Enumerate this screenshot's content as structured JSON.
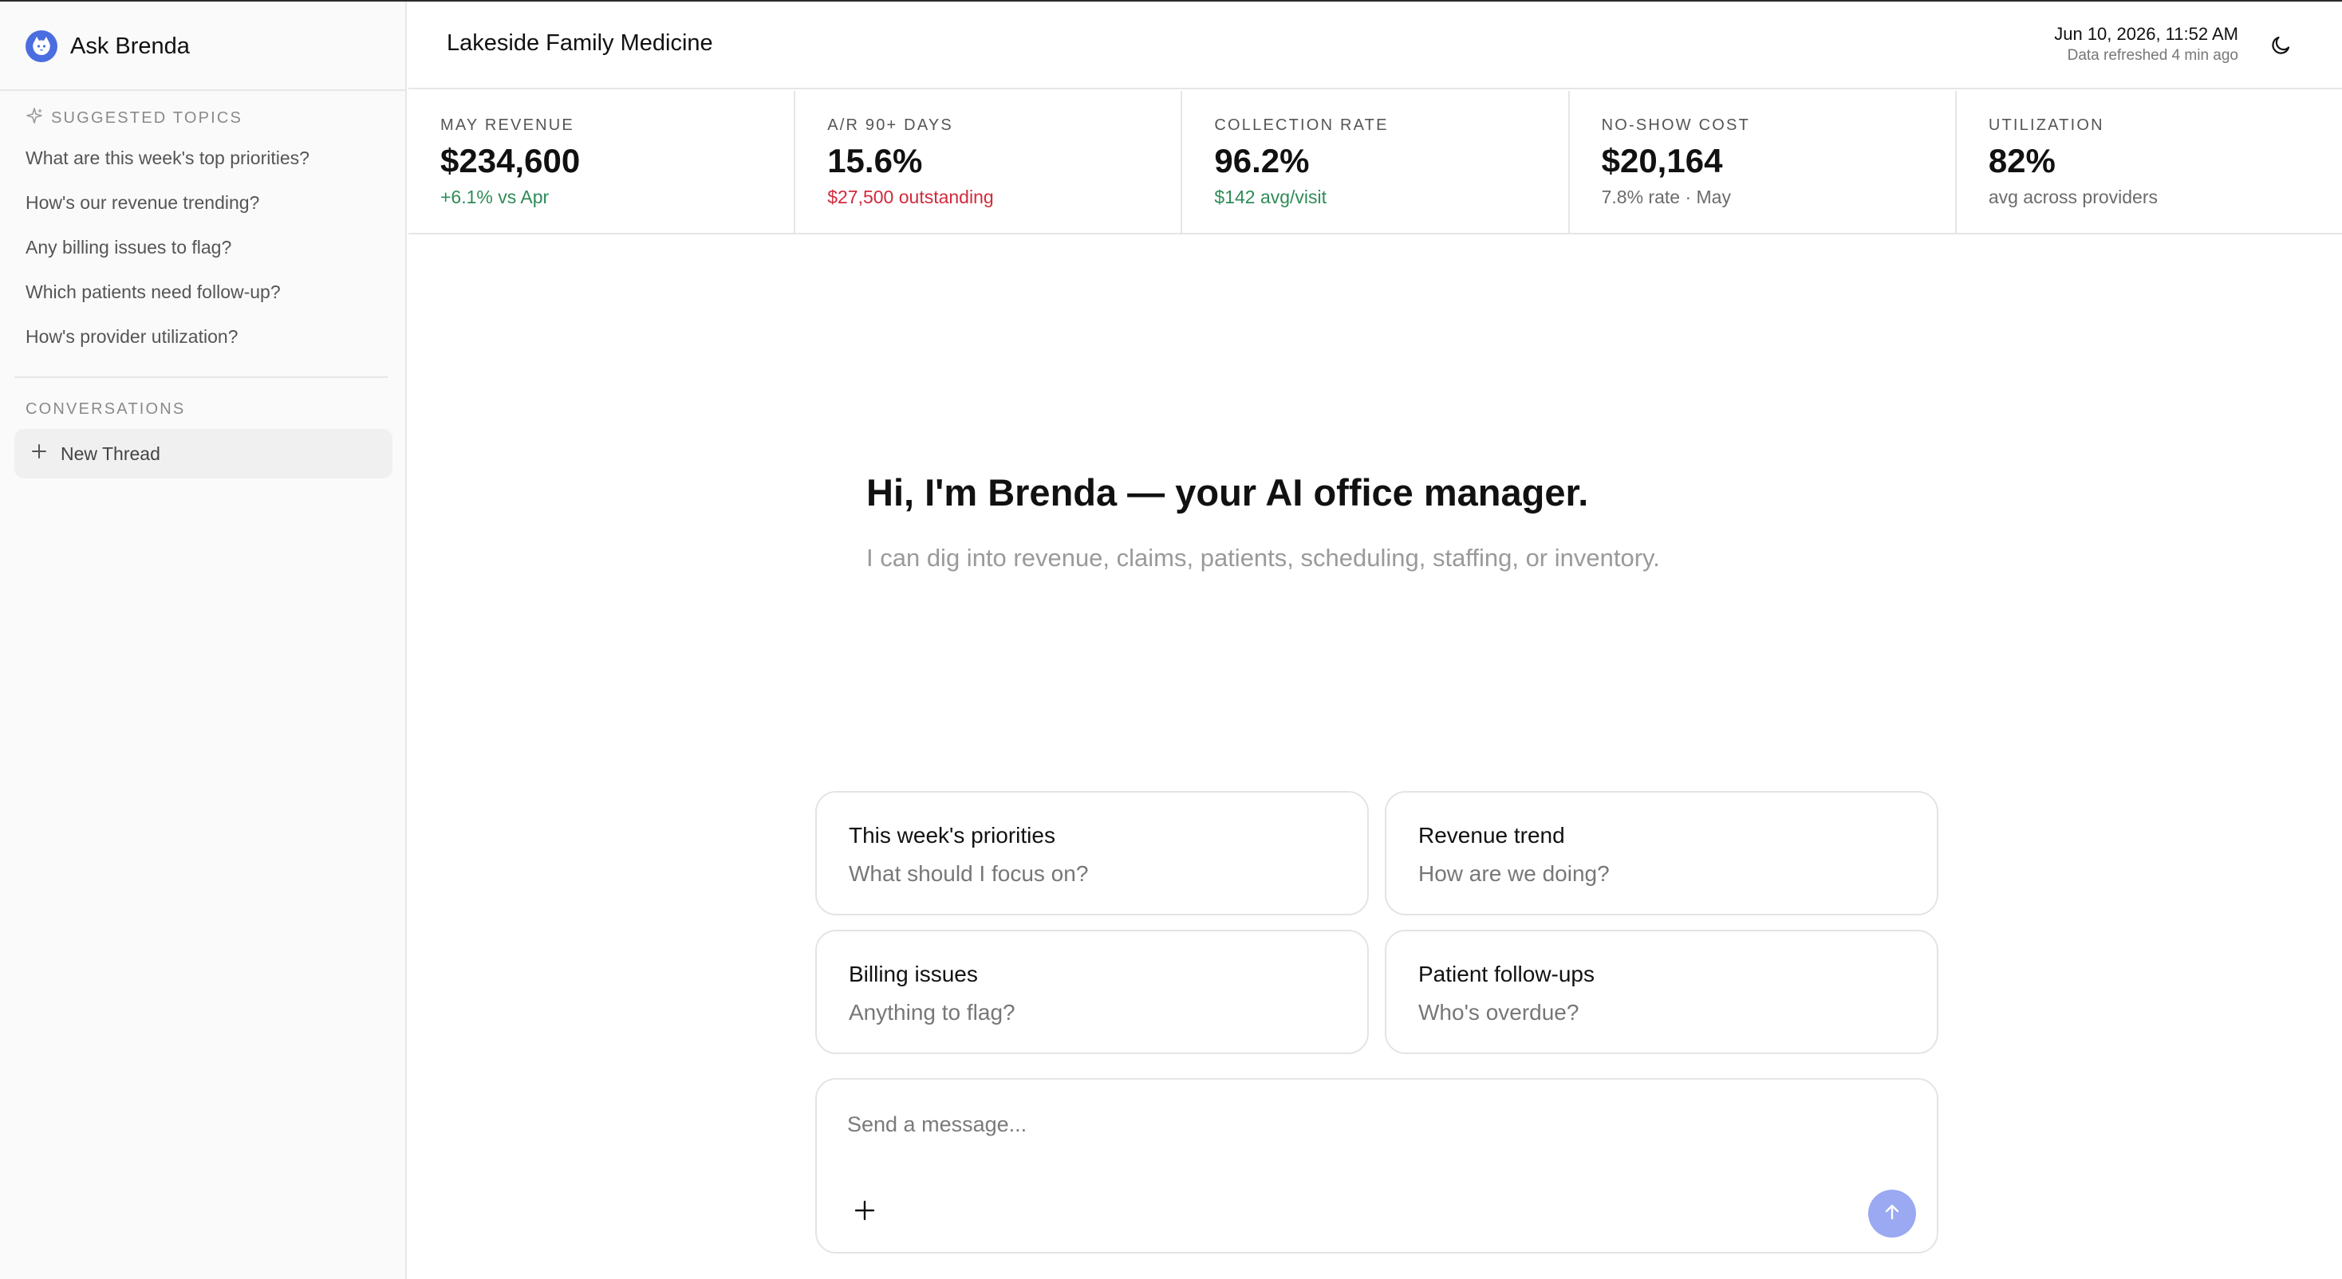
{
  "app": {
    "title": "Ask Brenda",
    "accent_color": "#4a6ee0"
  },
  "sidebar": {
    "suggested_label": "SUGGESTED TOPICS",
    "topics": [
      {
        "label": "What are this week's top priorities?"
      },
      {
        "label": "How's our revenue trending?"
      },
      {
        "label": "Any billing issues to flag?"
      },
      {
        "label": "Which patients need follow-up?"
      },
      {
        "label": "How's provider utilization?"
      }
    ],
    "conversations_label": "CONVERSATIONS",
    "new_thread_label": "New Thread",
    "icons": {
      "topics": "sparkle-icon",
      "new_thread": "plus-icon"
    }
  },
  "header": {
    "practice_name": "Lakeside Family Medicine",
    "datetime": "Jun 10, 2026, 11:52 AM",
    "refreshed": "Data refreshed 4 min ago",
    "theme_icon": "moon-icon"
  },
  "kpis": [
    {
      "label": "MAY REVENUE",
      "value": "$234,600",
      "sub": "+6.1% vs Apr",
      "sub_color": "#2e8b57"
    },
    {
      "label": "A/R 90+ DAYS",
      "value": "15.6%",
      "sub": "$27,500 outstanding",
      "sub_color": "#d12a3c"
    },
    {
      "label": "COLLECTION RATE",
      "value": "96.2%",
      "sub": "$142 avg/visit",
      "sub_color": "#2e8b57"
    },
    {
      "label": "NO-SHOW COST",
      "value": "$20,164",
      "sub": "7.8% rate · May",
      "sub_color": "#6b6b6b"
    },
    {
      "label": "UTILIZATION",
      "value": "82%",
      "sub": "avg across providers",
      "sub_color": "#6b6b6b"
    }
  ],
  "hero": {
    "title": "Hi, I'm Brenda — your AI office manager.",
    "subtitle": "I can dig into revenue, claims, patients, scheduling, staffing, or inventory."
  },
  "cards": [
    {
      "title": "This week's priorities",
      "subtitle": "What should I focus on?"
    },
    {
      "title": "Revenue trend",
      "subtitle": "How are we doing?"
    },
    {
      "title": "Billing issues",
      "subtitle": "Anything to flag?"
    },
    {
      "title": "Patient follow-ups",
      "subtitle": "Who's overdue?"
    }
  ],
  "composer": {
    "value": "",
    "placeholder": "Send a message...",
    "attach_icon": "plus-icon",
    "send_icon": "arrow-up-icon",
    "send_color": "#9aa9f2"
  }
}
